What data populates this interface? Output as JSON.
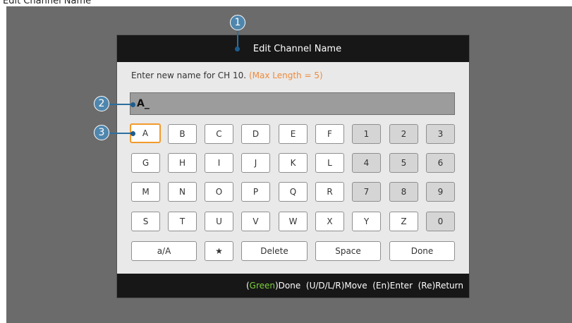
{
  "page_caption": "Edit Channel Name",
  "dialog": {
    "title": "Edit Channel Name",
    "instruction": "Enter new name for CH 10.",
    "max_length_note": "(Max Length = 5)",
    "name_value": "A_"
  },
  "keys": {
    "row1": [
      "A",
      "B",
      "C",
      "D",
      "E",
      "F",
      "1",
      "2",
      "3"
    ],
    "row2": [
      "G",
      "H",
      "I",
      "J",
      "K",
      "L",
      "4",
      "5",
      "6"
    ],
    "row3": [
      "M",
      "N",
      "O",
      "P",
      "Q",
      "R",
      "7",
      "8",
      "9"
    ],
    "row4": [
      "S",
      "T",
      "U",
      "V",
      "W",
      "X",
      "Y",
      "Z",
      "0"
    ],
    "actions": {
      "case": "a/A",
      "star": "★",
      "delete": "Delete",
      "space": "Space",
      "done": "Done"
    },
    "selected": "A"
  },
  "footer": {
    "green_word": "Green",
    "done_suffix": ")Done",
    "hints": "(U/D/L/R)Move  (En)Enter  (Re)Return"
  },
  "markers": [
    "1",
    "2",
    "3"
  ],
  "colors": {
    "accent_orange": "#f29b2c",
    "limit_text": "#f08a3a",
    "footer_green": "#7bd13b",
    "marker_blue": "#4f86ad"
  }
}
